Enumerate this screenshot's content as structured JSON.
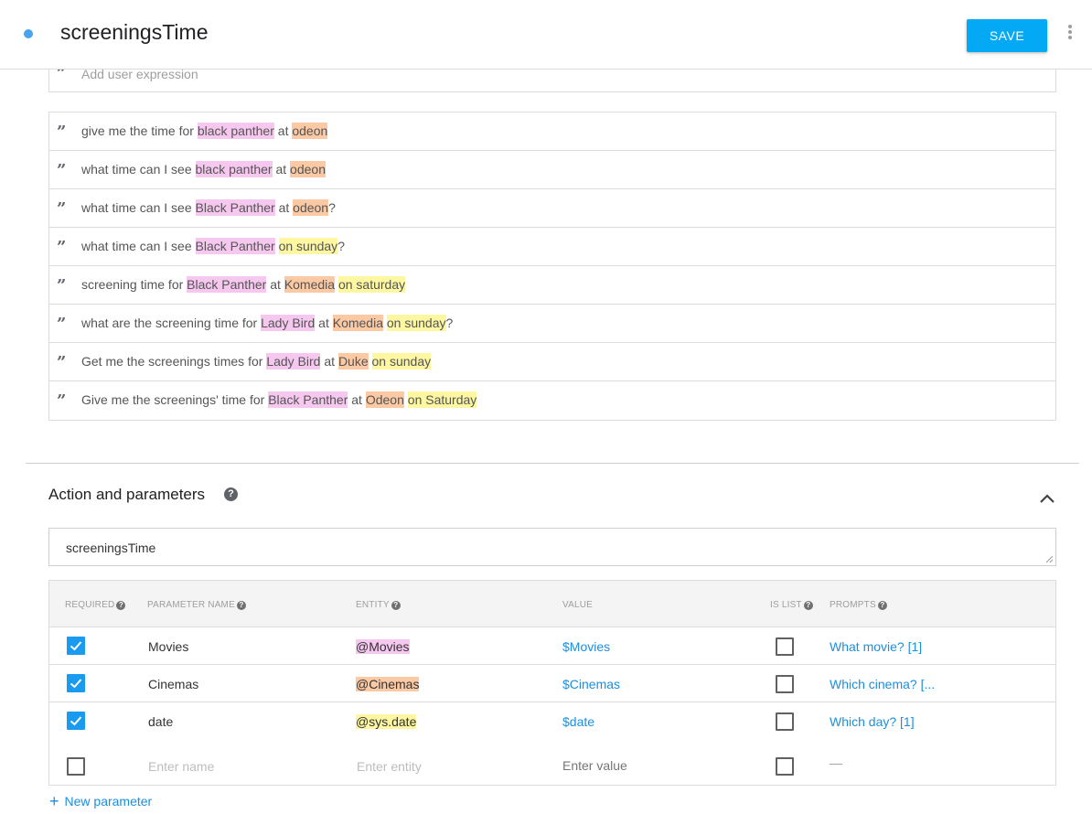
{
  "header": {
    "intent_name": "screeningsTime",
    "save_label": "SAVE"
  },
  "training_phrases": {
    "add_placeholder": "Add user expression",
    "items": [
      [
        {
          "t": "give me the time for ",
          "e": ""
        },
        {
          "t": "black panther",
          "e": "movie"
        },
        {
          "t": " at ",
          "e": ""
        },
        {
          "t": "odeon",
          "e": "cinema"
        }
      ],
      [
        {
          "t": "what time can I see ",
          "e": ""
        },
        {
          "t": "black panther",
          "e": "movie"
        },
        {
          "t": " at ",
          "e": ""
        },
        {
          "t": "odeon",
          "e": "cinema"
        }
      ],
      [
        {
          "t": "what time can I see ",
          "e": ""
        },
        {
          "t": "Black Panther",
          "e": "movie"
        },
        {
          "t": " at ",
          "e": ""
        },
        {
          "t": "odeon",
          "e": "cinema"
        },
        {
          "t": "?",
          "e": ""
        }
      ],
      [
        {
          "t": "what time can I see ",
          "e": ""
        },
        {
          "t": "Black Panther",
          "e": "movie"
        },
        {
          "t": " ",
          "e": ""
        },
        {
          "t": "on sunday",
          "e": "date"
        },
        {
          "t": "?",
          "e": ""
        }
      ],
      [
        {
          "t": "screening time for ",
          "e": ""
        },
        {
          "t": "Black Panther",
          "e": "movie"
        },
        {
          "t": " at ",
          "e": ""
        },
        {
          "t": "Komedia",
          "e": "cinema"
        },
        {
          "t": " ",
          "e": ""
        },
        {
          "t": "on saturday",
          "e": "date"
        }
      ],
      [
        {
          "t": "what are the screening time for ",
          "e": ""
        },
        {
          "t": "Lady Bird",
          "e": "movie"
        },
        {
          "t": " at ",
          "e": ""
        },
        {
          "t": "Komedia",
          "e": "cinema"
        },
        {
          "t": " ",
          "e": ""
        },
        {
          "t": "on sunday",
          "e": "date"
        },
        {
          "t": "?",
          "e": ""
        }
      ],
      [
        {
          "t": "Get me the screenings times for ",
          "e": ""
        },
        {
          "t": "Lady Bird",
          "e": "movie"
        },
        {
          "t": " at ",
          "e": ""
        },
        {
          "t": "Duke",
          "e": "cinema"
        },
        {
          "t": " ",
          "e": ""
        },
        {
          "t": "on sunday",
          "e": "date"
        }
      ],
      [
        {
          "t": "Give me the screenings' time for ",
          "e": ""
        },
        {
          "t": "Black Panther",
          "e": "movie"
        },
        {
          "t": " at ",
          "e": ""
        },
        {
          "t": "Odeon",
          "e": "cinema"
        },
        {
          "t": " ",
          "e": ""
        },
        {
          "t": "on Saturday",
          "e": "date"
        }
      ]
    ]
  },
  "actions": {
    "section_title": "Action and parameters",
    "action_value": "screeningsTime",
    "columns": {
      "required": "REQUIRED",
      "parameter_name": "PARAMETER NAME",
      "entity": "ENTITY",
      "value": "VALUE",
      "is_list": "IS LIST",
      "prompts": "PROMPTS"
    },
    "parameters": [
      {
        "required": true,
        "name": "Movies",
        "entity": "@Movies",
        "entity_type": "movie",
        "value": "$Movies",
        "is_list": false,
        "prompts": "What movie? [1]"
      },
      {
        "required": true,
        "name": "Cinemas",
        "entity": "@Cinemas",
        "entity_type": "cinema",
        "value": "$Cinemas",
        "is_list": false,
        "prompts": "Which cinema? [..."
      },
      {
        "required": true,
        "name": "date",
        "entity": "@sys.date",
        "entity_type": "date",
        "value": "$date",
        "is_list": false,
        "prompts": "Which day? [1]"
      }
    ],
    "new_row": {
      "name_placeholder": "Enter name",
      "entity_placeholder": "Enter entity",
      "value_placeholder": "Enter value",
      "prompts_placeholder": "—"
    },
    "new_parameter_label": "New parameter"
  },
  "colors": {
    "accent": "#03a9f4",
    "movie_highlight": "#f6c8f0",
    "cinema_highlight": "#fbc9a4",
    "date_highlight": "#fdf7a1"
  }
}
